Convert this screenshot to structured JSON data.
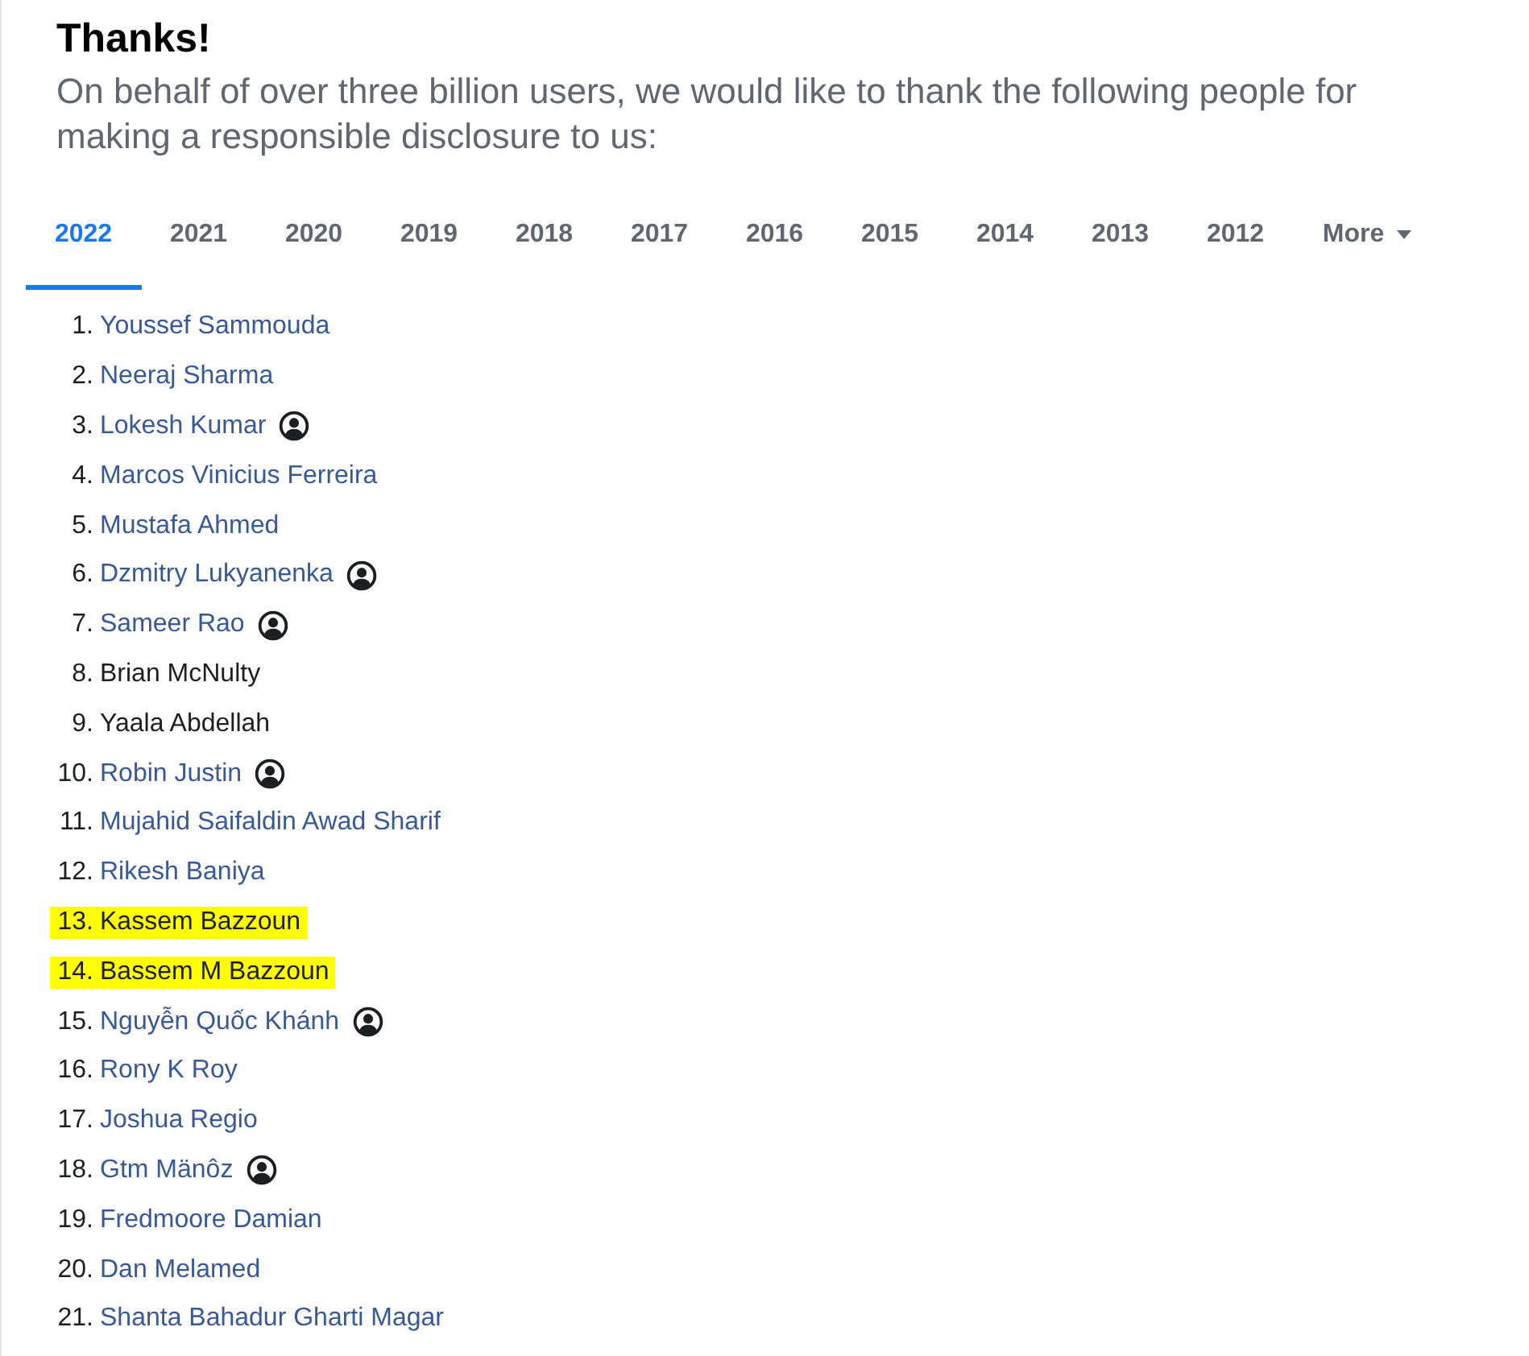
{
  "title": "Thanks!",
  "subtitle": "On behalf of over three billion users, we would like to thank the following people for making a responsible disclosure to us:",
  "tabs": [
    {
      "label": "2022",
      "selected": true
    },
    {
      "label": "2021",
      "selected": false
    },
    {
      "label": "2020",
      "selected": false
    },
    {
      "label": "2019",
      "selected": false
    },
    {
      "label": "2018",
      "selected": false
    },
    {
      "label": "2017",
      "selected": false
    },
    {
      "label": "2016",
      "selected": false
    },
    {
      "label": "2015",
      "selected": false
    },
    {
      "label": "2014",
      "selected": false
    },
    {
      "label": "2013",
      "selected": false
    },
    {
      "label": "2012",
      "selected": false
    },
    {
      "label": "More",
      "selected": false,
      "kind": "dropdown"
    }
  ],
  "people": [
    {
      "number": "1.",
      "name": "Youssef Sammouda",
      "link": true,
      "profile": false,
      "highlighted": false
    },
    {
      "number": "2.",
      "name": "Neeraj Sharma",
      "link": true,
      "profile": false,
      "highlighted": false
    },
    {
      "number": "3.",
      "name": "Lokesh Kumar",
      "link": true,
      "profile": true,
      "highlighted": false
    },
    {
      "number": "4.",
      "name": "Marcos Vinicius Ferreira",
      "link": true,
      "profile": false,
      "highlighted": false
    },
    {
      "number": "5.",
      "name": "Mustafa Ahmed",
      "link": true,
      "profile": false,
      "highlighted": false
    },
    {
      "number": "6.",
      "name": "Dzmitry Lukyanenka",
      "link": true,
      "profile": true,
      "highlighted": false
    },
    {
      "number": "7.",
      "name": "Sameer Rao",
      "link": true,
      "profile": true,
      "highlighted": false
    },
    {
      "number": "8.",
      "name": "Brian McNulty",
      "link": false,
      "profile": false,
      "highlighted": false
    },
    {
      "number": "9.",
      "name": "Yaala Abdellah",
      "link": false,
      "profile": false,
      "highlighted": false
    },
    {
      "number": "10.",
      "name": "Robin Justin",
      "link": true,
      "profile": true,
      "highlighted": false
    },
    {
      "number": "11.",
      "name": "Mujahid Saifaldin Awad Sharif",
      "link": true,
      "profile": false,
      "highlighted": false
    },
    {
      "number": "12.",
      "name": "Rikesh Baniya",
      "link": true,
      "profile": false,
      "highlighted": false
    },
    {
      "number": "13.",
      "name": "Kassem Bazzoun",
      "link": false,
      "profile": false,
      "highlighted": true
    },
    {
      "number": "14.",
      "name": "Bassem M Bazzoun",
      "link": false,
      "profile": false,
      "highlighted": true
    },
    {
      "number": "15.",
      "name": "Nguyễn Quốc Khánh",
      "link": true,
      "profile": true,
      "highlighted": false
    },
    {
      "number": "16.",
      "name": "Rony K Roy",
      "link": true,
      "profile": false,
      "highlighted": false
    },
    {
      "number": "17.",
      "name": "Joshua Regio",
      "link": true,
      "profile": false,
      "highlighted": false
    },
    {
      "number": "18.",
      "name": "Gtm Mänôz",
      "link": true,
      "profile": true,
      "highlighted": false
    },
    {
      "number": "19.",
      "name": "Fredmoore Damian",
      "link": true,
      "profile": false,
      "highlighted": false
    },
    {
      "number": "20.",
      "name": "Dan Melamed",
      "link": true,
      "profile": false,
      "highlighted": false
    },
    {
      "number": "21.",
      "name": "Shanta Bahadur Gharti Magar",
      "link": true,
      "profile": false,
      "highlighted": false
    }
  ]
}
